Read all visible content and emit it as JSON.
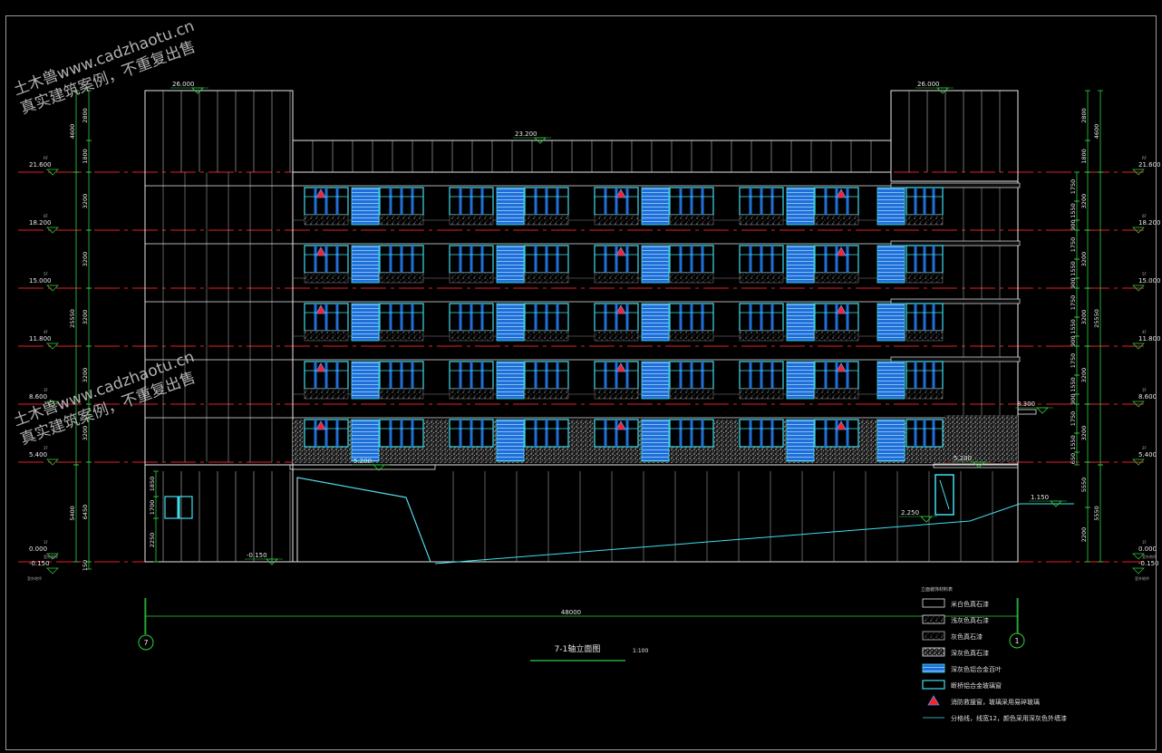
{
  "watermark": {
    "line1": "土木兽www.cadzhaotu.cn",
    "line2": "真实建筑案例，不重复出售"
  },
  "drawing": {
    "title": "7-1轴立面图",
    "scale": "1:100",
    "overall_width": "48000",
    "axis_left": "7",
    "axis_right": "1"
  },
  "elevations": {
    "tower_top": "26.000",
    "mid_parapet": "23.200",
    "roof": "21.600",
    "f6": "18.200",
    "f5": "15.000",
    "f4": "11.800",
    "f3": "8.600",
    "f2": "5.400",
    "f1": "0.000",
    "ground": "-0.150",
    "canopy_left": "5.200",
    "canopy_right": "5.200",
    "step": "8.300",
    "ramp_low": "-0.150",
    "ramp_mid": "2.250",
    "ramp_high": "1.150"
  },
  "dims_left": {
    "top": "2800",
    "parapet": "4600",
    "parapet_b": "1800",
    "floor_a": "1750",
    "floor_b": "3200",
    "floor_c": "1550",
    "floor_d": "900",
    "total": "25550",
    "ground_a": "1850",
    "ground_b": "5400",
    "ground_c": "6450",
    "ground_d": "1700",
    "ground_e": "2250",
    "ground_f": "150"
  },
  "dims_right": {
    "top": "2800",
    "parapet": "4600",
    "parapet_b": "1800",
    "floor_a": "1750",
    "floor_b": "3200",
    "floor_c": "1550",
    "floor_d": "900",
    "total": "25550",
    "ground_b": "5550",
    "ground_c": "2200",
    "ground_d": "650"
  },
  "level_tags": {
    "roof": "RF",
    "f6": "6F",
    "f5": "5F",
    "f4": "4F",
    "f3": "3F",
    "f2": "2F",
    "f1": "1F",
    "ground": "室外地坪"
  },
  "legend": {
    "title": "立面装饰材料表",
    "items": [
      {
        "label": "米白色真石漆",
        "swatch": "plain"
      },
      {
        "label": "浅灰色真石漆",
        "swatch": "speckle"
      },
      {
        "label": "灰色真石漆",
        "swatch": "speckle2"
      },
      {
        "label": "深灰色真石漆",
        "swatch": "dense"
      },
      {
        "label": "深灰色铝合金百叶",
        "swatch": "louver"
      },
      {
        "label": "断桥铝合金玻璃窗",
        "swatch": "window"
      },
      {
        "label": "消防救援窗，玻璃采用易碎玻璃",
        "swatch": "triangle"
      },
      {
        "label": "分格线，线宽12，颜色采用深灰色外墙漆",
        "swatch": "line"
      }
    ]
  },
  "colors": {
    "background": "#000000",
    "outline": "#e8e8e8",
    "cyan": "#3fe0f0",
    "blue": "#1f6fd8",
    "red_dash": "#e0202a",
    "green": "#30d040",
    "red_mark": "#ff2020"
  }
}
